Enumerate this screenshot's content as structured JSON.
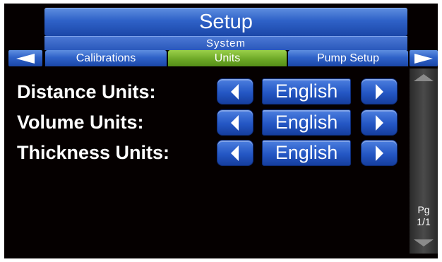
{
  "header": {
    "title": "Setup",
    "category": "System"
  },
  "tabs": [
    {
      "label": "Calibrations",
      "active": false
    },
    {
      "label": "Units",
      "active": true
    },
    {
      "label": "Pump Setup",
      "active": false
    }
  ],
  "settings": [
    {
      "label": "Distance Units:",
      "value": "English"
    },
    {
      "label": "Volume Units:",
      "value": "English"
    },
    {
      "label": "Thickness Units:",
      "value": "English"
    }
  ],
  "pager": {
    "page_label": "Pg",
    "page_value": "1/1"
  },
  "colors": {
    "primary_blue": "#2f62c8",
    "active_tab_green": "#6aa524",
    "background": "#050000"
  },
  "icons": {
    "prev_tab": "left-triangle-icon",
    "next_tab": "right-triangle-icon",
    "decrement": "left-arrow-icon",
    "increment": "right-arrow-icon",
    "scroll_up": "up-triangle-icon",
    "scroll_down": "down-triangle-icon"
  }
}
